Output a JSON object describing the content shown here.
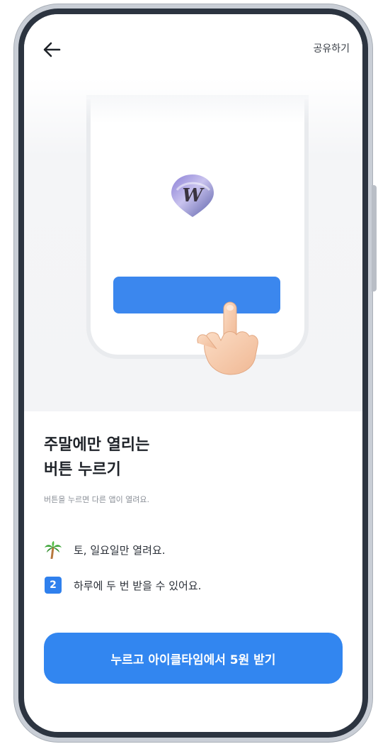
{
  "header": {
    "back_icon": "arrow-left-icon",
    "share_label": "공유하기"
  },
  "illustration": {
    "logo_letter": "W",
    "logo_icon": "w-gem-logo",
    "hand_icon": "pointing-hand-icon"
  },
  "content": {
    "title_line1": "주말에만 열리는",
    "title_line2": "버튼 누르기",
    "subtitle": "버튼을 누르면 다른 앱이 열려요.",
    "features": [
      {
        "icon": "palm-tree-icon",
        "text": "토, 일요일만 열려요."
      },
      {
        "icon": "number-badge-icon",
        "badge": "2",
        "text": "하루에 두 번 받을 수 있어요."
      }
    ]
  },
  "cta": {
    "label": "누르고 아이클타임에서 5원 받기"
  },
  "colors": {
    "accent": "#3286f0",
    "badge": "#2f80ed",
    "frame": "#2c3440"
  }
}
